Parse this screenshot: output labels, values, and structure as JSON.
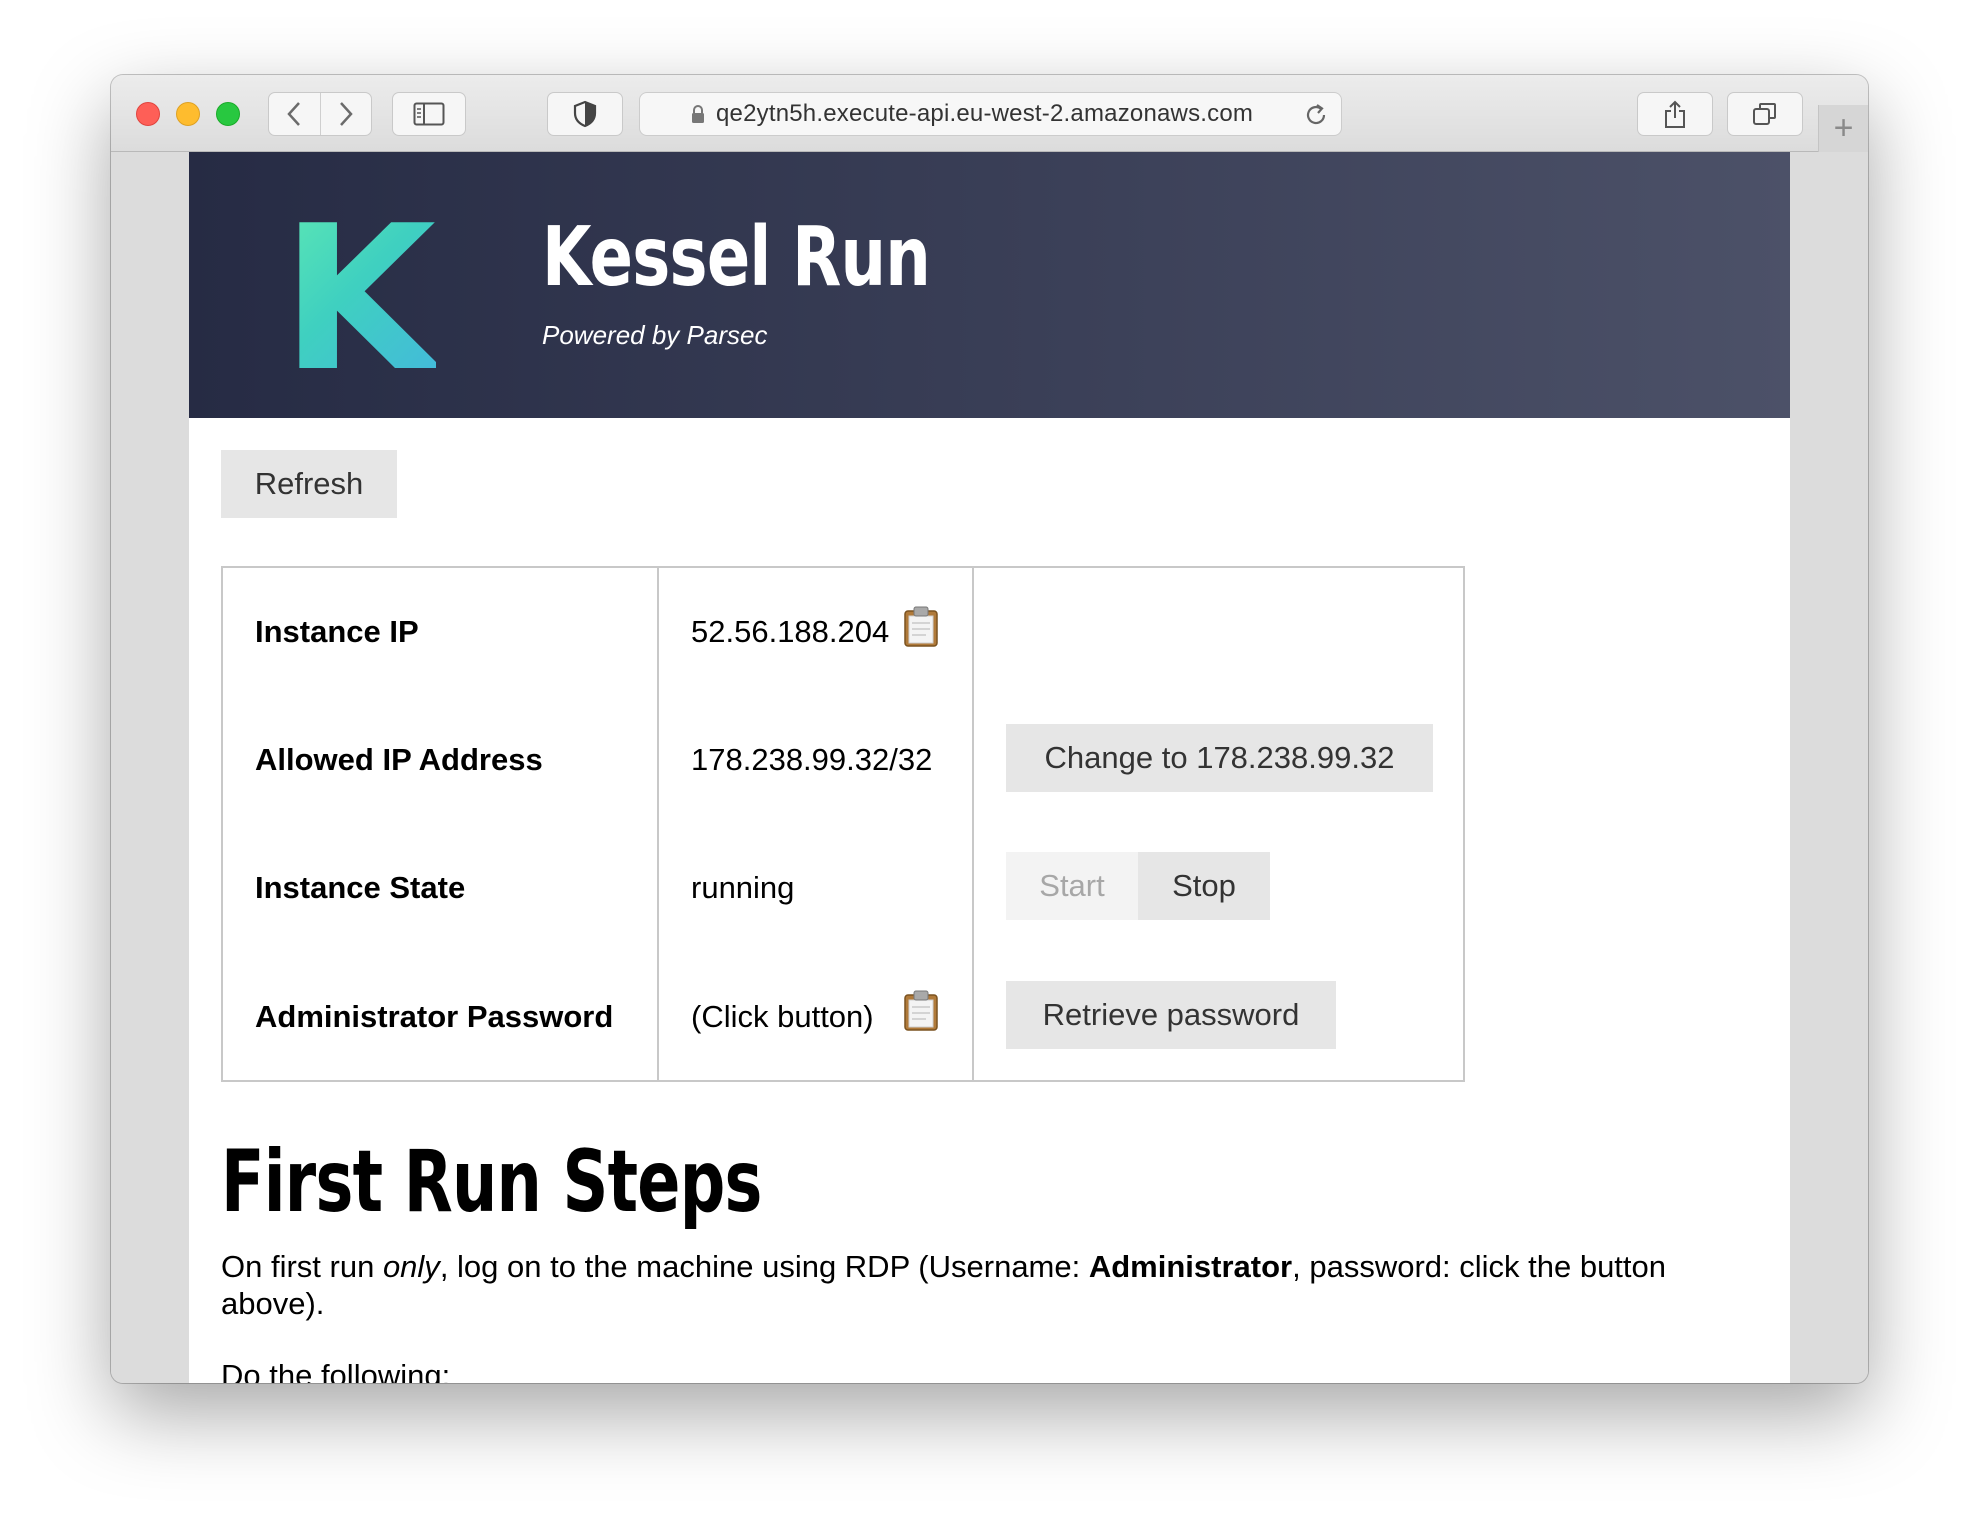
{
  "browser": {
    "url": "qe2ytn5h.execute-api.eu-west-2.amazonaws.com",
    "new_tab": "+"
  },
  "header": {
    "logo_letter": "K",
    "title": "Kessel Run",
    "subtitle": "Powered by Parsec",
    "colors": {
      "bg_start": "#262b44",
      "bg_end": "#4c5168",
      "logo_start": "#5de8b4",
      "logo_end": "#44b7de"
    }
  },
  "refresh_label": "Refresh",
  "table": {
    "rows": [
      {
        "label": "Instance IP",
        "value": "52.56.188.204"
      },
      {
        "label": "Allowed IP Address",
        "value": "178.238.99.32/32"
      },
      {
        "label": "Instance State",
        "value": "running"
      },
      {
        "label": "Administrator Password",
        "value": "(Click button)"
      }
    ],
    "change_ip_label": "Change to 178.238.99.32",
    "start_label": "Start",
    "stop_label": "Stop",
    "retrieve_label": "Retrieve password"
  },
  "first_run": {
    "heading": "First Run Steps",
    "p1_before": "On first run ",
    "p1_em": "only",
    "p1_mid": ", log on to the machine using RDP (Username: ",
    "p1_strong": "Administrator",
    "p1_after": ", password: click the button above).",
    "p2": "Do the following:"
  }
}
